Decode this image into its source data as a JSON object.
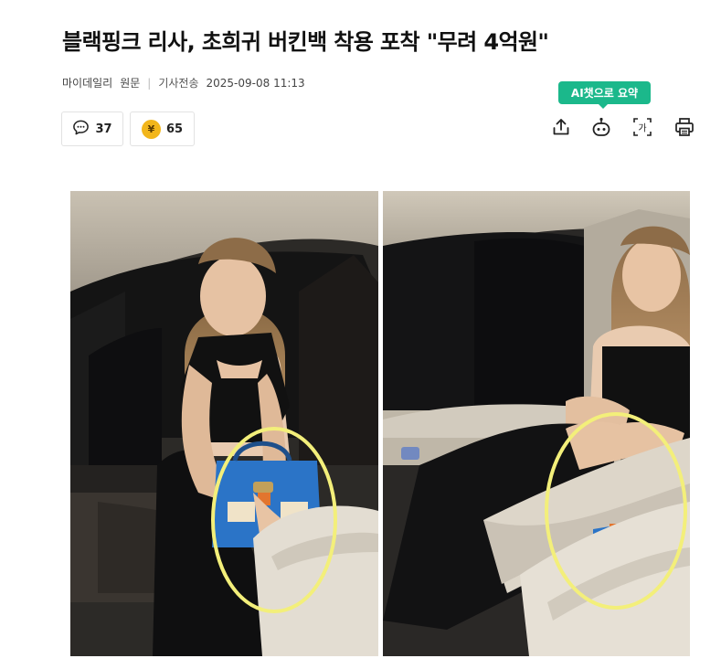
{
  "article": {
    "headline": "블랙핑크 리사, 초희귀 버킨백 착용 포착 \"무려 4억원\"",
    "source": "마이데일리",
    "original_link": "원문",
    "sent_label": "기사전송",
    "timestamp": "2025-09-08 11:13"
  },
  "stats": {
    "comments": "37",
    "reactions": "65",
    "coin_symbol": "¥"
  },
  "tools": {
    "ai_badge": "AI챗으로 요약",
    "font_size_glyph": "가",
    "icons": [
      "share-icon",
      "ai-summary-icon",
      "font-size-icon",
      "print-icon"
    ]
  },
  "colors": {
    "ai_badge": "#1bb88b",
    "coin": "#f2b61b",
    "highlight_circle": "#f3ef7a"
  }
}
